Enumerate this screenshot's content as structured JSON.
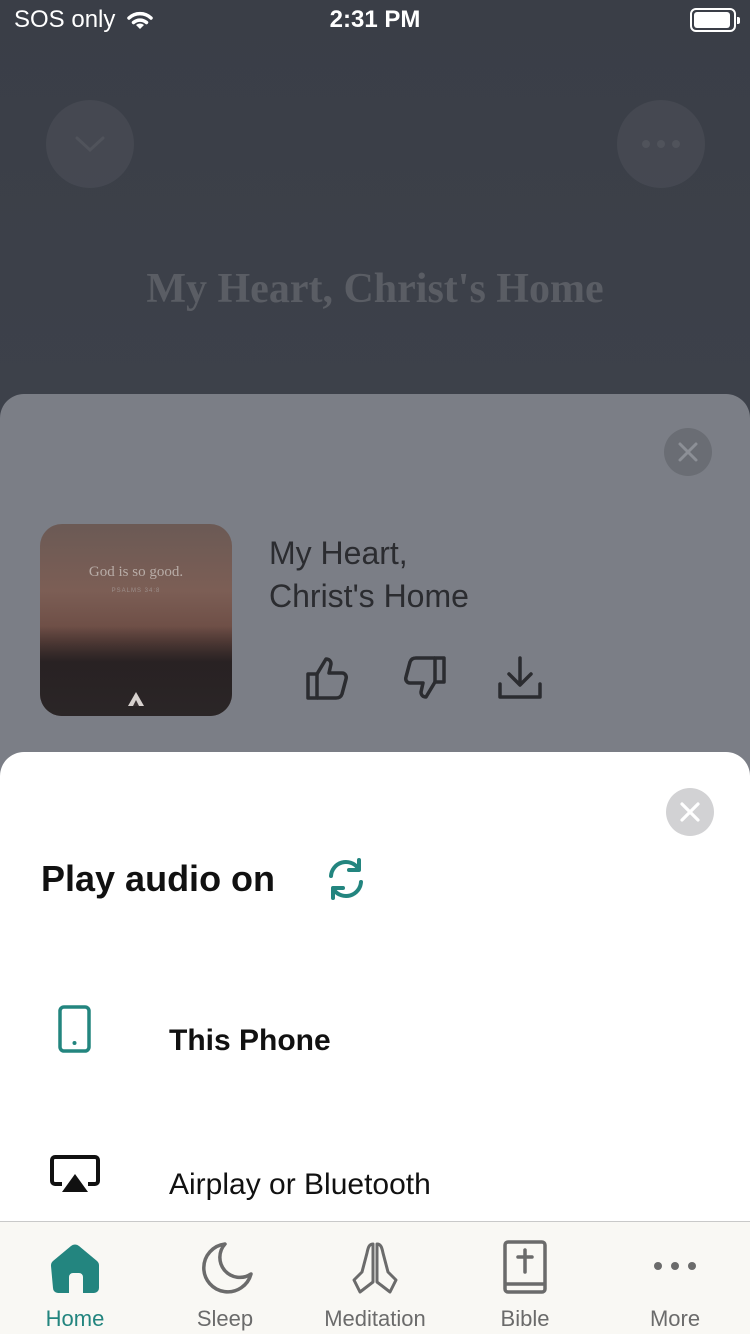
{
  "status_bar": {
    "carrier": "SOS only",
    "time": "2:31 PM"
  },
  "player_background": {
    "title": "My Heart, Christ's Home"
  },
  "now_playing": {
    "title_line1": "My Heart,",
    "title_line2": "Christ's Home",
    "artwork_text": "God is so good.",
    "artwork_subtext": "PSALMS 34:8",
    "artwork_logo": "abide"
  },
  "audio_sheet": {
    "title": "Play audio on",
    "options": [
      {
        "label": "This Phone",
        "icon": "phone-icon",
        "selected": true
      },
      {
        "label": "Airplay or Bluetooth",
        "icon": "airplay-icon",
        "selected": false
      }
    ]
  },
  "tabbar": {
    "items": [
      {
        "label": "Home",
        "icon": "home-icon",
        "active": true
      },
      {
        "label": "Sleep",
        "icon": "moon-icon",
        "active": false
      },
      {
        "label": "Meditation",
        "icon": "praying-hands-icon",
        "active": false
      },
      {
        "label": "Bible",
        "icon": "bible-icon",
        "active": false
      },
      {
        "label": "More",
        "icon": "more-icon",
        "active": false
      }
    ]
  },
  "colors": {
    "accent": "#23857f",
    "sheet": "#ffffff",
    "tabbar": "#f9f8f4"
  }
}
